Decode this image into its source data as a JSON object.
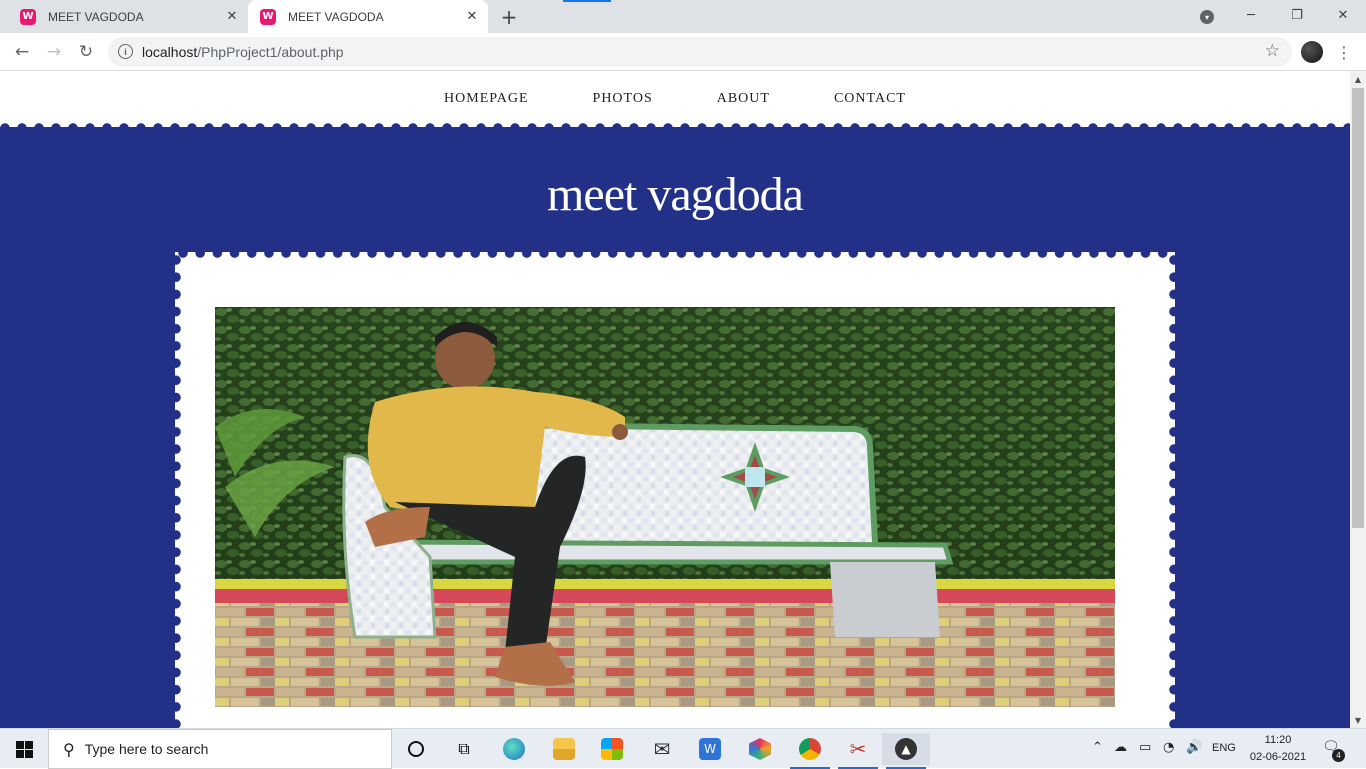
{
  "browser": {
    "tabs": [
      {
        "title": "MEET VAGDODA",
        "favicon": "W"
      },
      {
        "title": "MEET VAGDODA",
        "favicon": "W"
      }
    ],
    "url_host": "localhost",
    "url_path": "/PhpProject1/about.php"
  },
  "site": {
    "nav": [
      "HOMEPAGE",
      "PHOTOS",
      "ABOUT",
      "CONTACT"
    ],
    "title": "meet vagdoda",
    "colors": {
      "accent": "#223187",
      "card": "#ffffff"
    }
  },
  "taskbar": {
    "search_placeholder": "Type here to search",
    "language": "ENG",
    "time": "11:20",
    "date": "02-06-2021",
    "notifications": "4"
  }
}
